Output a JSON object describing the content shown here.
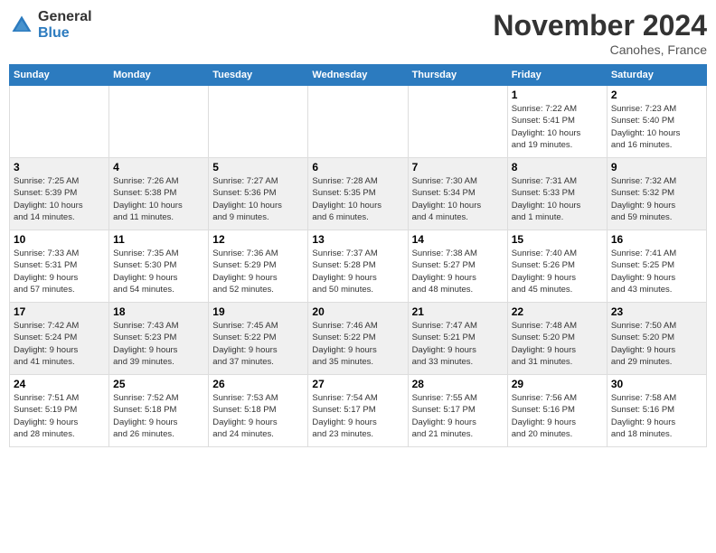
{
  "header": {
    "logo_line1": "General",
    "logo_line2": "Blue",
    "month_title": "November 2024",
    "location": "Canohes, France"
  },
  "weekdays": [
    "Sunday",
    "Monday",
    "Tuesday",
    "Wednesday",
    "Thursday",
    "Friday",
    "Saturday"
  ],
  "weeks": [
    [
      {
        "day": "",
        "info": ""
      },
      {
        "day": "",
        "info": ""
      },
      {
        "day": "",
        "info": ""
      },
      {
        "day": "",
        "info": ""
      },
      {
        "day": "",
        "info": ""
      },
      {
        "day": "1",
        "info": "Sunrise: 7:22 AM\nSunset: 5:41 PM\nDaylight: 10 hours\nand 19 minutes."
      },
      {
        "day": "2",
        "info": "Sunrise: 7:23 AM\nSunset: 5:40 PM\nDaylight: 10 hours\nand 16 minutes."
      }
    ],
    [
      {
        "day": "3",
        "info": "Sunrise: 7:25 AM\nSunset: 5:39 PM\nDaylight: 10 hours\nand 14 minutes."
      },
      {
        "day": "4",
        "info": "Sunrise: 7:26 AM\nSunset: 5:38 PM\nDaylight: 10 hours\nand 11 minutes."
      },
      {
        "day": "5",
        "info": "Sunrise: 7:27 AM\nSunset: 5:36 PM\nDaylight: 10 hours\nand 9 minutes."
      },
      {
        "day": "6",
        "info": "Sunrise: 7:28 AM\nSunset: 5:35 PM\nDaylight: 10 hours\nand 6 minutes."
      },
      {
        "day": "7",
        "info": "Sunrise: 7:30 AM\nSunset: 5:34 PM\nDaylight: 10 hours\nand 4 minutes."
      },
      {
        "day": "8",
        "info": "Sunrise: 7:31 AM\nSunset: 5:33 PM\nDaylight: 10 hours\nand 1 minute."
      },
      {
        "day": "9",
        "info": "Sunrise: 7:32 AM\nSunset: 5:32 PM\nDaylight: 9 hours\nand 59 minutes."
      }
    ],
    [
      {
        "day": "10",
        "info": "Sunrise: 7:33 AM\nSunset: 5:31 PM\nDaylight: 9 hours\nand 57 minutes."
      },
      {
        "day": "11",
        "info": "Sunrise: 7:35 AM\nSunset: 5:30 PM\nDaylight: 9 hours\nand 54 minutes."
      },
      {
        "day": "12",
        "info": "Sunrise: 7:36 AM\nSunset: 5:29 PM\nDaylight: 9 hours\nand 52 minutes."
      },
      {
        "day": "13",
        "info": "Sunrise: 7:37 AM\nSunset: 5:28 PM\nDaylight: 9 hours\nand 50 minutes."
      },
      {
        "day": "14",
        "info": "Sunrise: 7:38 AM\nSunset: 5:27 PM\nDaylight: 9 hours\nand 48 minutes."
      },
      {
        "day": "15",
        "info": "Sunrise: 7:40 AM\nSunset: 5:26 PM\nDaylight: 9 hours\nand 45 minutes."
      },
      {
        "day": "16",
        "info": "Sunrise: 7:41 AM\nSunset: 5:25 PM\nDaylight: 9 hours\nand 43 minutes."
      }
    ],
    [
      {
        "day": "17",
        "info": "Sunrise: 7:42 AM\nSunset: 5:24 PM\nDaylight: 9 hours\nand 41 minutes."
      },
      {
        "day": "18",
        "info": "Sunrise: 7:43 AM\nSunset: 5:23 PM\nDaylight: 9 hours\nand 39 minutes."
      },
      {
        "day": "19",
        "info": "Sunrise: 7:45 AM\nSunset: 5:22 PM\nDaylight: 9 hours\nand 37 minutes."
      },
      {
        "day": "20",
        "info": "Sunrise: 7:46 AM\nSunset: 5:22 PM\nDaylight: 9 hours\nand 35 minutes."
      },
      {
        "day": "21",
        "info": "Sunrise: 7:47 AM\nSunset: 5:21 PM\nDaylight: 9 hours\nand 33 minutes."
      },
      {
        "day": "22",
        "info": "Sunrise: 7:48 AM\nSunset: 5:20 PM\nDaylight: 9 hours\nand 31 minutes."
      },
      {
        "day": "23",
        "info": "Sunrise: 7:50 AM\nSunset: 5:20 PM\nDaylight: 9 hours\nand 29 minutes."
      }
    ],
    [
      {
        "day": "24",
        "info": "Sunrise: 7:51 AM\nSunset: 5:19 PM\nDaylight: 9 hours\nand 28 minutes."
      },
      {
        "day": "25",
        "info": "Sunrise: 7:52 AM\nSunset: 5:18 PM\nDaylight: 9 hours\nand 26 minutes."
      },
      {
        "day": "26",
        "info": "Sunrise: 7:53 AM\nSunset: 5:18 PM\nDaylight: 9 hours\nand 24 minutes."
      },
      {
        "day": "27",
        "info": "Sunrise: 7:54 AM\nSunset: 5:17 PM\nDaylight: 9 hours\nand 23 minutes."
      },
      {
        "day": "28",
        "info": "Sunrise: 7:55 AM\nSunset: 5:17 PM\nDaylight: 9 hours\nand 21 minutes."
      },
      {
        "day": "29",
        "info": "Sunrise: 7:56 AM\nSunset: 5:16 PM\nDaylight: 9 hours\nand 20 minutes."
      },
      {
        "day": "30",
        "info": "Sunrise: 7:58 AM\nSunset: 5:16 PM\nDaylight: 9 hours\nand 18 minutes."
      }
    ]
  ]
}
